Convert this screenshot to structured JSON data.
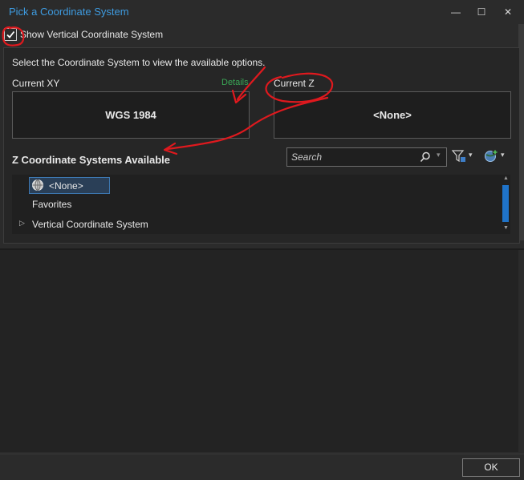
{
  "window": {
    "title": "Pick a Coordinate System",
    "minimize_glyph": "—",
    "maximize_glyph": "☐",
    "close_glyph": "✕"
  },
  "options": {
    "show_vertical_label": "Show Vertical Coordinate System",
    "show_vertical_checked": true
  },
  "instructions": "Select the Coordinate System to view the available options.",
  "current_xy": {
    "label": "Current XY",
    "details_link": "Details",
    "value": "WGS 1984"
  },
  "current_z": {
    "label": "Current Z",
    "value": "<None>"
  },
  "available": {
    "heading": "Z Coordinate Systems Available",
    "search_placeholder": "Search",
    "tree": [
      {
        "label": "<None>",
        "selected": true,
        "icon": "globe-icon"
      },
      {
        "label": "Favorites",
        "selected": false
      },
      {
        "label": "Vertical Coordinate System",
        "selected": false,
        "expandable": true
      }
    ]
  },
  "footer": {
    "ok_label": "OK"
  },
  "colors": {
    "title": "#3e9be0",
    "details": "#3aa655",
    "annotation": "#e0191e",
    "selection": "#2a3f57"
  }
}
